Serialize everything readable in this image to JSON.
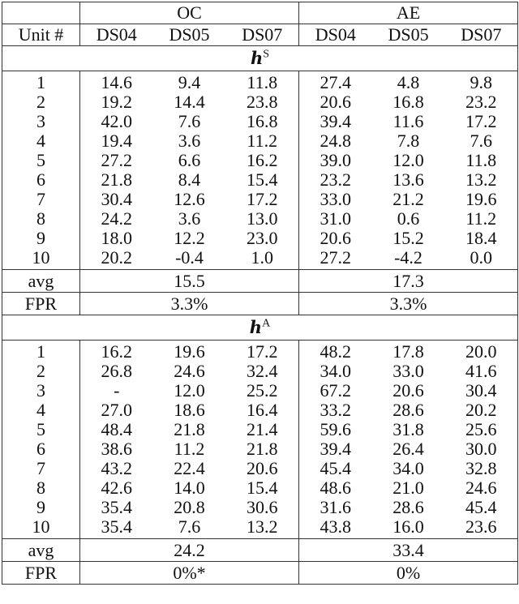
{
  "header": {
    "groups": [
      "OC",
      "AE"
    ],
    "unit_label": "Unit #",
    "datasets": [
      "DS04",
      "DS05",
      "DS07",
      "DS04",
      "DS05",
      "DS07"
    ]
  },
  "sections": [
    {
      "var": "h",
      "sup": "S",
      "rows": [
        {
          "unit": "1",
          "values": [
            "14.6",
            "9.4",
            "11.8",
            "27.4",
            "4.8",
            "9.8"
          ]
        },
        {
          "unit": "2",
          "values": [
            "19.2",
            "14.4",
            "23.8",
            "20.6",
            "16.8",
            "23.2"
          ]
        },
        {
          "unit": "3",
          "values": [
            "42.0",
            "7.6",
            "16.8",
            "39.4",
            "11.6",
            "17.2"
          ]
        },
        {
          "unit": "4",
          "values": [
            "19.4",
            "3.6",
            "11.2",
            "24.8",
            "7.8",
            "7.6"
          ]
        },
        {
          "unit": "5",
          "values": [
            "27.2",
            "6.6",
            "16.2",
            "39.0",
            "12.0",
            "11.8"
          ]
        },
        {
          "unit": "6",
          "values": [
            "21.8",
            "8.4",
            "15.4",
            "23.2",
            "13.6",
            "13.2"
          ]
        },
        {
          "unit": "7",
          "values": [
            "30.4",
            "12.6",
            "17.2",
            "33.0",
            "21.2",
            "19.6"
          ]
        },
        {
          "unit": "8",
          "values": [
            "24.2",
            "3.6",
            "13.0",
            "31.0",
            "0.6",
            "11.2"
          ]
        },
        {
          "unit": "9",
          "values": [
            "18.0",
            "12.2",
            "23.0",
            "20.6",
            "15.2",
            "18.4"
          ]
        },
        {
          "unit": "10",
          "values": [
            "20.2",
            "-0.4",
            "1.0",
            "27.2",
            "-4.2",
            "0.0"
          ]
        }
      ],
      "avg": {
        "label": "avg",
        "oc": "15.5",
        "ae": "17.3"
      },
      "fpr": {
        "label": "FPR",
        "oc": "3.3%",
        "ae": "3.3%"
      }
    },
    {
      "var": "h",
      "sup": "A",
      "rows": [
        {
          "unit": "1",
          "values": [
            "16.2",
            "19.6",
            "17.2",
            "48.2",
            "17.8",
            "20.0"
          ]
        },
        {
          "unit": "2",
          "values": [
            "26.8",
            "24.6",
            "32.4",
            "34.0",
            "33.0",
            "41.6"
          ]
        },
        {
          "unit": "3",
          "values": [
            "-",
            "12.0",
            "25.2",
            "67.2",
            "20.6",
            "30.4"
          ]
        },
        {
          "unit": "4",
          "values": [
            "27.0",
            "18.6",
            "16.4",
            "33.2",
            "28.6",
            "20.2"
          ]
        },
        {
          "unit": "5",
          "values": [
            "48.4",
            "21.8",
            "21.4",
            "59.6",
            "31.8",
            "25.6"
          ]
        },
        {
          "unit": "6",
          "values": [
            "38.6",
            "11.2",
            "21.8",
            "39.4",
            "26.4",
            "30.0"
          ]
        },
        {
          "unit": "7",
          "values": [
            "43.2",
            "22.4",
            "20.6",
            "45.4",
            "34.0",
            "32.8"
          ]
        },
        {
          "unit": "8",
          "values": [
            "42.6",
            "14.0",
            "15.4",
            "48.6",
            "21.0",
            "24.6"
          ]
        },
        {
          "unit": "9",
          "values": [
            "35.4",
            "20.8",
            "30.6",
            "31.6",
            "28.6",
            "45.4"
          ]
        },
        {
          "unit": "10",
          "values": [
            "35.4",
            "7.6",
            "13.2",
            "43.8",
            "16.0",
            "23.6"
          ]
        }
      ],
      "avg": {
        "label": "avg",
        "oc": "24.2",
        "ae": "33.4"
      },
      "fpr": {
        "label": "FPR",
        "oc": "0%*",
        "ae": "0%"
      }
    }
  ]
}
